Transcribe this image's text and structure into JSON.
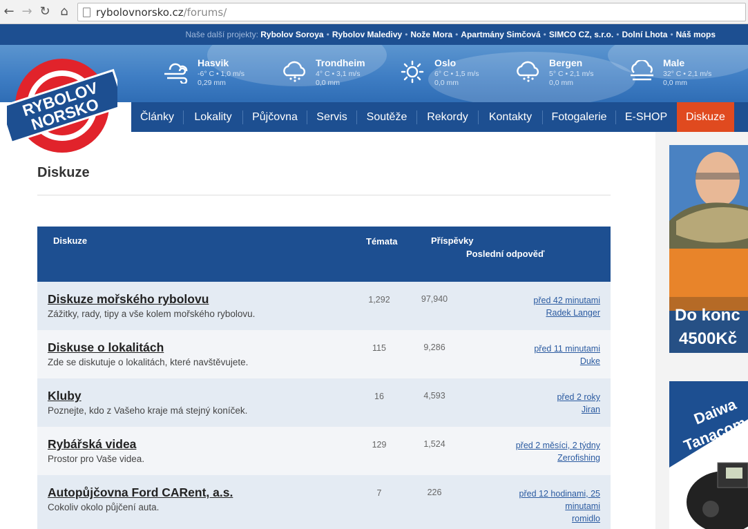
{
  "browser": {
    "url_domain": "rybolovnorsko.cz",
    "url_path": "/forums/"
  },
  "projects": {
    "label": "Naše další projekty:",
    "links": [
      "Rybolov Soroya",
      "Rybolov Maledivy",
      "Nože Mora",
      "Apartmány Simčová",
      "SIMCO CZ, s.r.o.",
      "Dolní Lhota",
      "Náš mops"
    ]
  },
  "logo": {
    "line1": "RYBOLOV",
    "line2": "NORSKO"
  },
  "weather": [
    {
      "city": "Hasvik",
      "line1": "-6° C • 1,0 m/s",
      "line2": "0,29 mm",
      "icon": "wind-cloud-icon"
    },
    {
      "city": "Trondheim",
      "line1": "4° C • 3,1 m/s",
      "line2": "0,0 mm",
      "icon": "snow-cloud-icon"
    },
    {
      "city": "Oslo",
      "line1": "6° C • 1,5 m/s",
      "line2": "0,0 mm",
      "icon": "sun-icon"
    },
    {
      "city": "Bergen",
      "line1": "5° C • 2,1 m/s",
      "line2": "0,0 mm",
      "icon": "snow-cloud-icon"
    },
    {
      "city": "Male",
      "line1": "32° C • 2,1 m/s",
      "line2": "0,0 mm",
      "icon": "fog-cloud-icon"
    }
  ],
  "nav": {
    "items": [
      "Články",
      "Lokality",
      "Půjčovna",
      "Servis",
      "Soutěže",
      "Rekordy",
      "Kontakty",
      "Fotogalerie",
      "E-SHOP",
      "Diskuze"
    ],
    "active": "Diskuze"
  },
  "page": {
    "title": "Diskuze"
  },
  "table": {
    "headers": {
      "forum": "Diskuze",
      "topics": "Témata",
      "posts": "Příspěvky",
      "last_reply": "Poslední odpověď"
    },
    "rows": [
      {
        "title": "Diskuze mořského rybolovu",
        "desc": "Zážitky, rady, tipy a vše kolem mořského rybolovu.",
        "topics": "1,292",
        "posts": "97,940",
        "last_time": "před 42 minutami",
        "last_user": "Radek Langer"
      },
      {
        "title": "Diskuse o lokalitách",
        "desc": "Zde se diskutuje o lokalitách, které navštěvujete.",
        "topics": "115",
        "posts": "9,286",
        "last_time": "před 11 minutami",
        "last_user": "Duke"
      },
      {
        "title": "Kluby",
        "desc": "Poznejte, kdo z Vašeho kraje má stejný koníček.",
        "topics": "16",
        "posts": "4,593",
        "last_time": "před 2 roky",
        "last_user": "Jiran"
      },
      {
        "title": "Rybářská videa",
        "desc": "Prostor pro Vaše videa.",
        "topics": "129",
        "posts": "1,524",
        "last_time": "před 2 měsíci, 2 týdny",
        "last_user": "Zerofishing"
      },
      {
        "title": "Autopůjčovna Ford CARent, a.s.",
        "desc": "Cokoliv okolo půjčení auta.",
        "topics": "7",
        "posts": "226",
        "last_time": "před 12 hodinami, 25 minutami",
        "last_user": "romidlo"
      }
    ]
  },
  "sidebar": {
    "ad1": {
      "line1": "Do konc",
      "line2": "4500Kč"
    },
    "ad2": {
      "line1": "Daiwa",
      "line2": "Tanacom"
    }
  },
  "colors": {
    "brand_blue": "#1d4f91",
    "active_orange": "#e04a1f",
    "link_blue": "#2a5aa0"
  }
}
